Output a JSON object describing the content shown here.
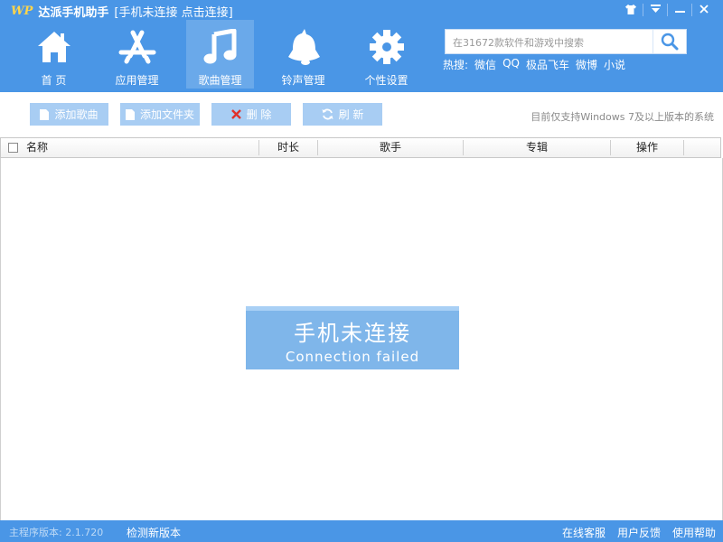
{
  "titlebar": {
    "logo": "WP",
    "app_name": "达派手机助手",
    "connection": "[手机未连接 点击连接]"
  },
  "window_controls": [
    "skin-icon",
    "menu-icon",
    "minimize-icon",
    "close-icon"
  ],
  "nav": [
    {
      "label": "首 页",
      "icon": "home-icon",
      "active": false
    },
    {
      "label": "应用管理",
      "icon": "app-store-icon",
      "active": false
    },
    {
      "label": "歌曲管理",
      "icon": "music-note-icon",
      "active": true
    },
    {
      "label": "铃声管理",
      "icon": "bell-icon",
      "active": false
    },
    {
      "label": "个性设置",
      "icon": "gear-icon",
      "active": false
    }
  ],
  "search": {
    "placeholder": "在31672款软件和游戏中搜索",
    "value": ""
  },
  "hot_search": {
    "label": "热搜:",
    "items": [
      "微信",
      "QQ",
      "极品飞车",
      "微博",
      "小说"
    ]
  },
  "toolbar": {
    "add_song": "添加歌曲",
    "add_folder": "添加文件夹",
    "delete": "删 除",
    "refresh": "刷 新",
    "note": "目前仅支持Windows 7及以上版本的系统"
  },
  "table": {
    "columns": [
      "名称",
      "时长",
      "歌手",
      "专辑",
      "操作"
    ],
    "rows": []
  },
  "empty_state": {
    "title": "手机未连接",
    "subtitle": "Connection failed"
  },
  "statusbar": {
    "version": "主程序版本: 2.1.720",
    "check_update": "检测新版本",
    "links": [
      "在线客服",
      "用户反馈",
      "使用帮助"
    ]
  },
  "colors": {
    "brand_blue": "#4a96e6",
    "active_nav": "#6aa9ea",
    "toolbar_button": "#a8cdf3",
    "empty_state_box": "#7fb6ea",
    "delete_icon": "#e0302b"
  }
}
